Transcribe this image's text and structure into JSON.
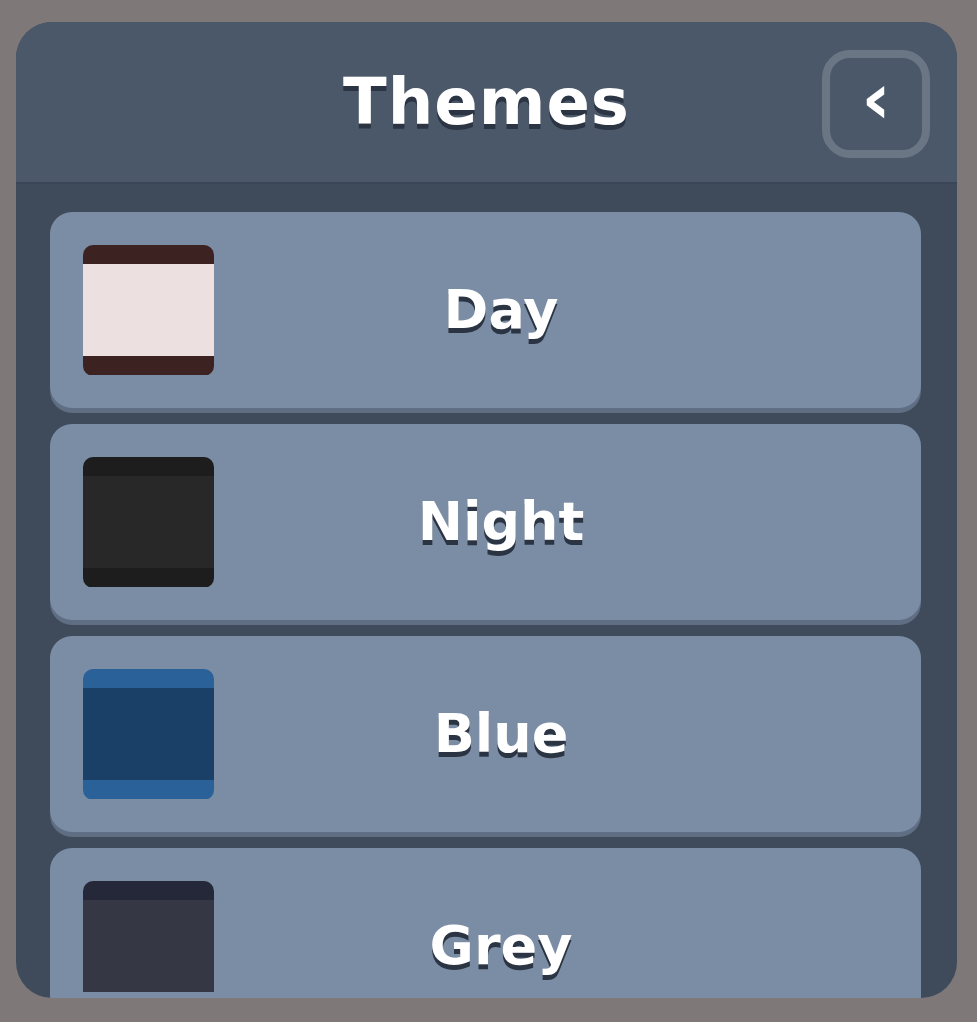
{
  "dialog": {
    "title": "Themes",
    "back_button": {
      "label": "‹"
    }
  },
  "themes": [
    {
      "name": "Day",
      "swatch": [
        {
          "color": "#3c2220"
        },
        {
          "color": "#ece0e0"
        },
        {
          "color": "#3c2220"
        }
      ]
    },
    {
      "name": "Night",
      "swatch": [
        {
          "color": "#1d1d1d"
        },
        {
          "color": "#282828"
        },
        {
          "color": "#1d1d1d"
        }
      ]
    },
    {
      "name": "Blue",
      "swatch": [
        {
          "color": "#2a6198"
        },
        {
          "color": "#1b4068"
        },
        {
          "color": "#2a6198"
        }
      ]
    },
    {
      "name": "Grey",
      "swatch": [
        {
          "color": "#252838"
        },
        {
          "color": "#363745"
        }
      ]
    }
  ]
}
